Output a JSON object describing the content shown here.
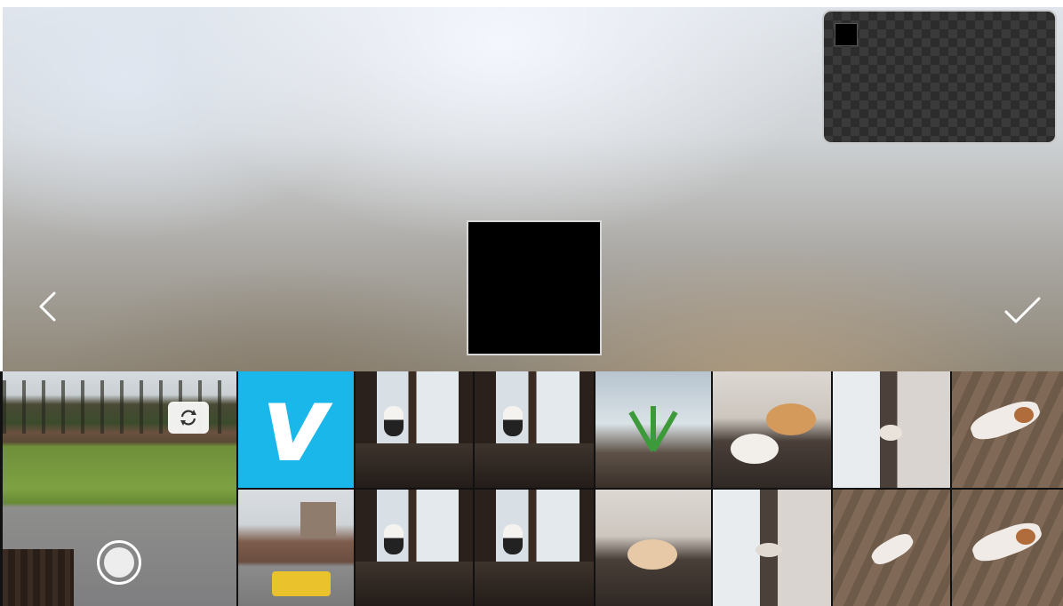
{
  "preview": {
    "back_icon": "chevron-left-icon",
    "confirm_icon": "checkmark-icon"
  },
  "pip": {
    "description": "checkerboard-transparent-thumbnail"
  },
  "camera_tile": {
    "flip_icon": "camera-flip-icon",
    "shutter_icon": "shutter-button-icon"
  },
  "gallery": {
    "items": [
      {
        "kind": "vimeo",
        "glyph": "v"
      },
      {
        "kind": "window-dog"
      },
      {
        "kind": "window-dog"
      },
      {
        "kind": "plant"
      },
      {
        "kind": "couch-dog"
      },
      {
        "kind": "room-dog"
      },
      {
        "kind": "floor-dogs"
      },
      {
        "kind": "street"
      },
      {
        "kind": "window-dog"
      },
      {
        "kind": "window-dog"
      },
      {
        "kind": "couch-dog"
      },
      {
        "kind": "room-dog"
      },
      {
        "kind": "floor-dog"
      },
      {
        "kind": "floor-dogs"
      }
    ]
  },
  "colors": {
    "vimeo_blue": "#1ab7ea",
    "background": "#ffffff"
  }
}
